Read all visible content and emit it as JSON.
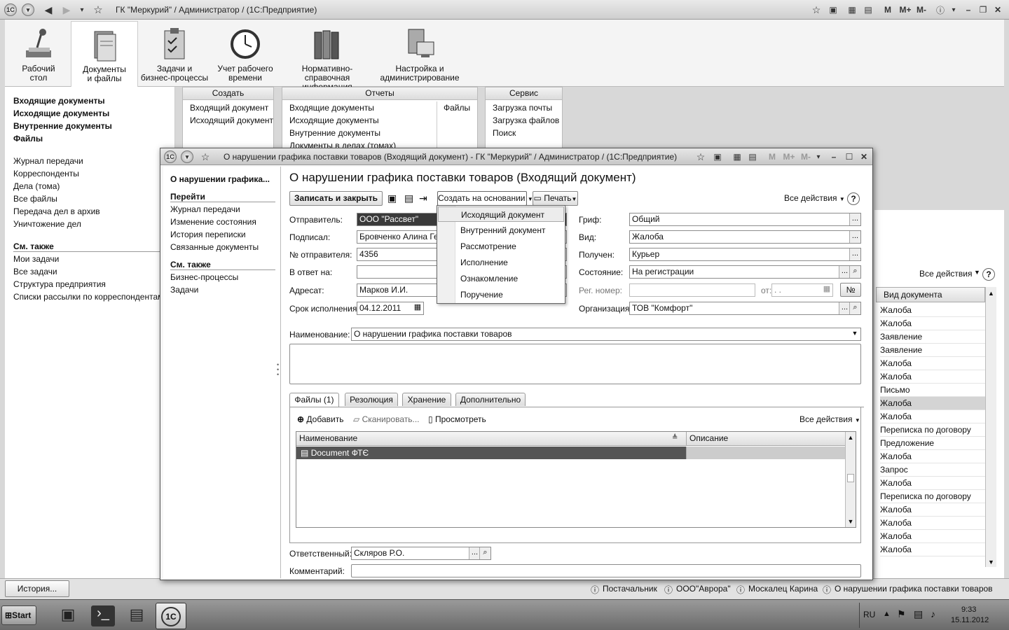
{
  "main_window": {
    "title": "ГК \"Меркурий\" / Администратор /  (1С:Предприятие)"
  },
  "sections": [
    {
      "label1": "Рабочий",
      "label2": "стол"
    },
    {
      "label1": "Документы",
      "label2": "и файлы"
    },
    {
      "label1": "Задачи и",
      "label2": "бизнес-процессы"
    },
    {
      "label1": "Учет рабочего",
      "label2": "времени"
    },
    {
      "label1": "Нормативно-справочная",
      "label2": "информация"
    },
    {
      "label1": "Настройка и",
      "label2": "администрирование"
    }
  ],
  "leftnav": {
    "bold": [
      "Входящие документы",
      "Исходящие документы",
      "Внутренние документы",
      "Файлы"
    ],
    "items": [
      "Журнал передачи",
      "Корреспонденты",
      "Дела (тома)",
      "Все файлы",
      "Передача дел в архив",
      "Уничтожение дел"
    ],
    "see_also": "См. также",
    "see_also_items": [
      "Мои задачи",
      "Все задачи",
      "Структура предприятия",
      "Списки рассылки по корреспондентам"
    ]
  },
  "panels": {
    "create": {
      "title": "Создать",
      "items": [
        "Входящий документ",
        "Исходящий документ"
      ]
    },
    "reports": {
      "title": "Отчеты",
      "items": [
        "Входящие документы",
        "Исходящие документы",
        "Внутренние документы",
        "Документы в делах (томах)"
      ],
      "right": "Файлы"
    },
    "service": {
      "title": "Сервис",
      "items": [
        "Загрузка почты",
        "Загрузка файлов",
        "Поиск"
      ]
    }
  },
  "bglist": {
    "all_actions": "Все действия",
    "header": "Вид документа",
    "rows": [
      "Жалоба",
      "Жалоба",
      "Заявление",
      "Заявление",
      "Жалоба",
      "Жалоба",
      "Письмо",
      "Жалоба",
      "Жалоба",
      "Переписка по договору",
      "Предложение",
      "Жалоба",
      "Запрос",
      "Жалоба",
      "Переписка по договору",
      "Жалоба",
      "Жалоба",
      "Жалоба",
      "Жалоба"
    ]
  },
  "statusbar": {
    "history": "История...",
    "items": [
      "Постачальник",
      "ООО\"Аврора\"",
      "Москалец Карина",
      "О нарушении графика поставки товаров"
    ]
  },
  "taskbar": {
    "start": "Start",
    "lang": "RU",
    "time": "9:33",
    "date": "15.11.2012"
  },
  "modal": {
    "title": "О нарушении графика поставки товаров (Входящий документ) - ГК \"Меркурий\" / Администратор /  (1С:Предприятие)",
    "side": {
      "heading": "О нарушении графика...",
      "goto": "Перейти",
      "goto_items": [
        "Журнал передачи",
        "Изменение состояния",
        "История переписки",
        "Связанные документы"
      ],
      "see_also": "См. также",
      "see_also_items": [
        "Бизнес-процессы",
        "Задачи"
      ]
    },
    "header": "О нарушении графика поставки товаров (Входящий документ)",
    "toolbar": {
      "save_close": "Записать и закрыть",
      "create_based": "Создать на основании",
      "print": "Печать",
      "all_actions": "Все действия"
    },
    "fields": {
      "sender_label": "Отправитель:",
      "sender": "ООО \"Рассвет\"",
      "signed_label": "Подписал:",
      "signed": "Бровченко Алина Генн",
      "sender_no_label": "№ отправителя:",
      "sender_no": "4356",
      "reply_label": "В ответ на:",
      "reply": "",
      "addressee_label": "Адресат:",
      "addressee": "Марков И.И.",
      "due_label": "Срок исполнения:",
      "due": "04.12.2011",
      "grif_label": "Гриф:",
      "grif": "Общий",
      "kind_label": "Вид:",
      "kind": "Жалоба",
      "received_label": "Получен:",
      "received": "Курьер",
      "state_label": "Состояние:",
      "state": "На регистрации",
      "reg_label": "Рег. номер:",
      "reg": "",
      "from_label": "от:",
      "from": " .  .",
      "org_label": "Организация:",
      "org": "ТОВ \"Комфорт\"",
      "name_label": "Наименование:",
      "name": "О нарушении графика поставки товаров",
      "responsible_label": "Ответственный:",
      "responsible": "Скляров Р.О.",
      "comment_label": "Комментарий:",
      "comment": ""
    },
    "tabs": [
      "Файлы (1)",
      "Резолюция",
      "Хранение",
      "Дополнительно"
    ],
    "files_toolbar": {
      "add": "Добавить",
      "scan": "Сканировать...",
      "view": "Просмотреть",
      "all_actions": "Все действия"
    },
    "files_table": {
      "col_name": "Наименование",
      "col_desc": "Описание",
      "rows": [
        {
          "name": "Document ФТЄ",
          "desc": ""
        }
      ]
    }
  },
  "dropdown": {
    "items": [
      "Исходящий документ",
      "Внутренний документ",
      "Рассмотрение",
      "Исполнение",
      "Ознакомление",
      "Поручение"
    ]
  }
}
